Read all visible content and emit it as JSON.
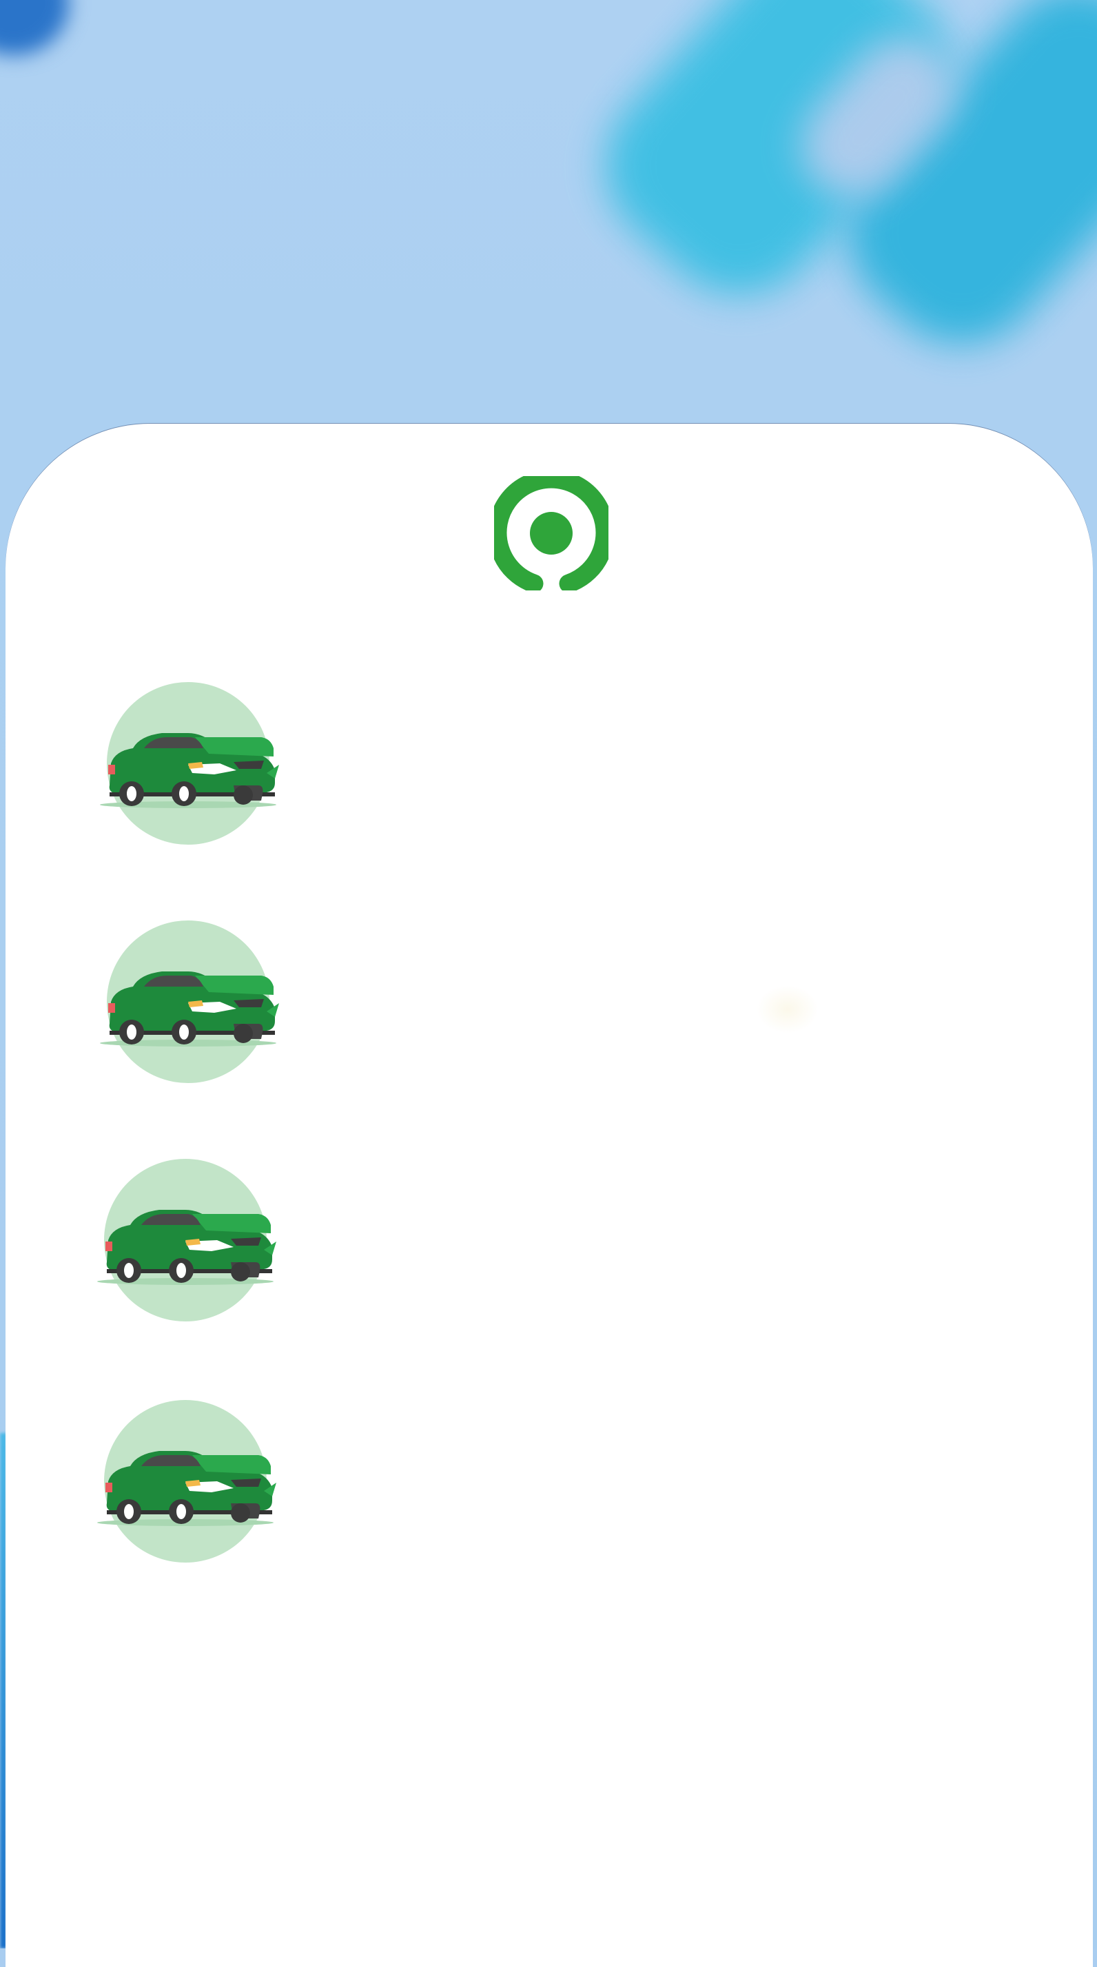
{
  "screen": {
    "title": ""
  },
  "brand": {
    "logo_icon": "gojek-logo-icon",
    "color": "#2fa53a"
  },
  "rides": [
    {
      "icon": "green-car-icon",
      "label": ""
    },
    {
      "icon": "green-car-icon",
      "label": ""
    },
    {
      "icon": "green-car-icon",
      "label": ""
    },
    {
      "icon": "green-car-icon",
      "label": ""
    }
  ],
  "colors": {
    "accent_green": "#2fa53a",
    "car_green": "#1f8f3f",
    "circle_green": "#c1e3c7",
    "background_blue": "#aed1f2",
    "sheet": "#ffffff"
  }
}
